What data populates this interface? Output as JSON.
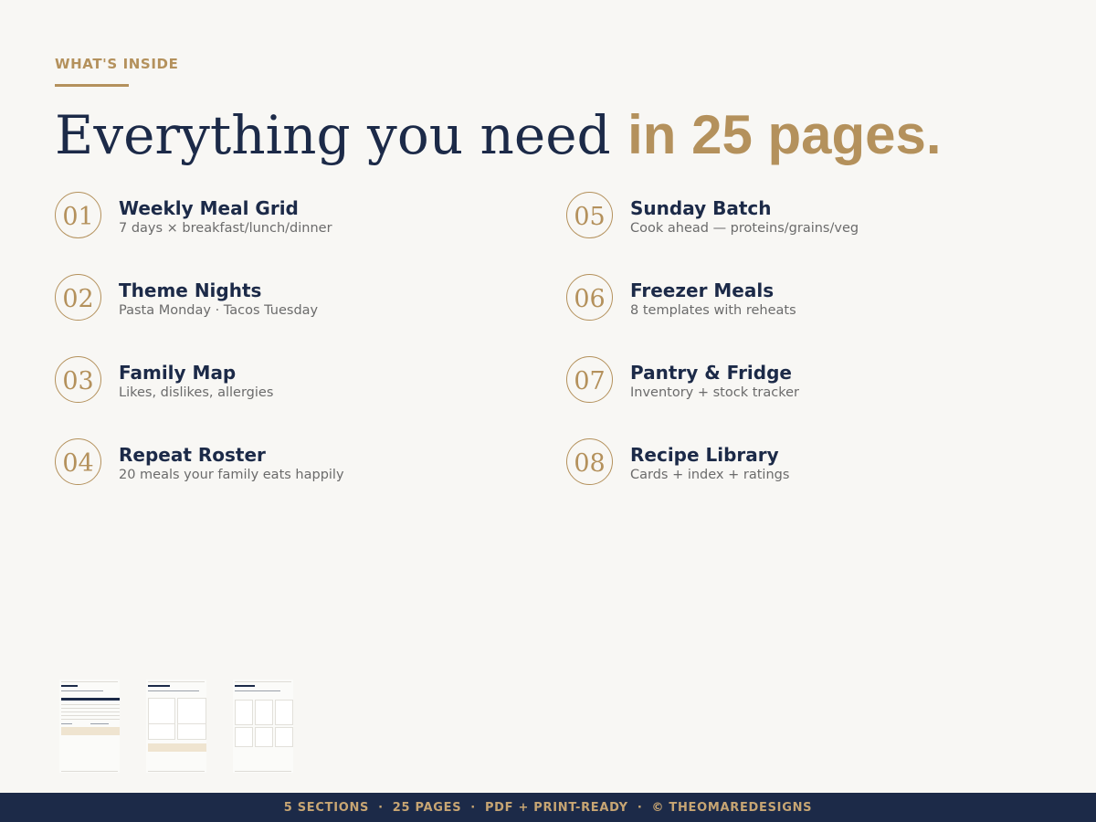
{
  "eyebrow": "WHAT'S INSIDE",
  "headline": {
    "main": "Everything you need ",
    "accent": "in 25 pages."
  },
  "items": [
    {
      "num": "01",
      "title": "Weekly Meal Grid",
      "sub": "7 days × breakfast/lunch/dinner"
    },
    {
      "num": "02",
      "title": "Theme Nights",
      "sub": "Pasta Monday · Tacos Tuesday"
    },
    {
      "num": "03",
      "title": "Family Map",
      "sub": "Likes, dislikes, allergies"
    },
    {
      "num": "04",
      "title": "Repeat Roster",
      "sub": "20 meals your family eats happily"
    },
    {
      "num": "05",
      "title": "Sunday Batch",
      "sub": "Cook ahead — proteins/grains/veg"
    },
    {
      "num": "06",
      "title": "Freezer Meals",
      "sub": "8 templates with reheats"
    },
    {
      "num": "07",
      "title": "Pantry & Fridge",
      "sub": "Inventory + stock tracker"
    },
    {
      "num": "08",
      "title": "Recipe Library",
      "sub": "Cards + index + ratings"
    }
  ],
  "footer": {
    "parts": [
      "5 SECTIONS",
      "25 PAGES",
      "PDF + PRINT-READY",
      "© THEOMAREDESIGNS"
    ],
    "separator": "·"
  },
  "colors": {
    "navy": "#1c2a48",
    "gold": "#b4915c",
    "background": "#f8f7f4"
  }
}
